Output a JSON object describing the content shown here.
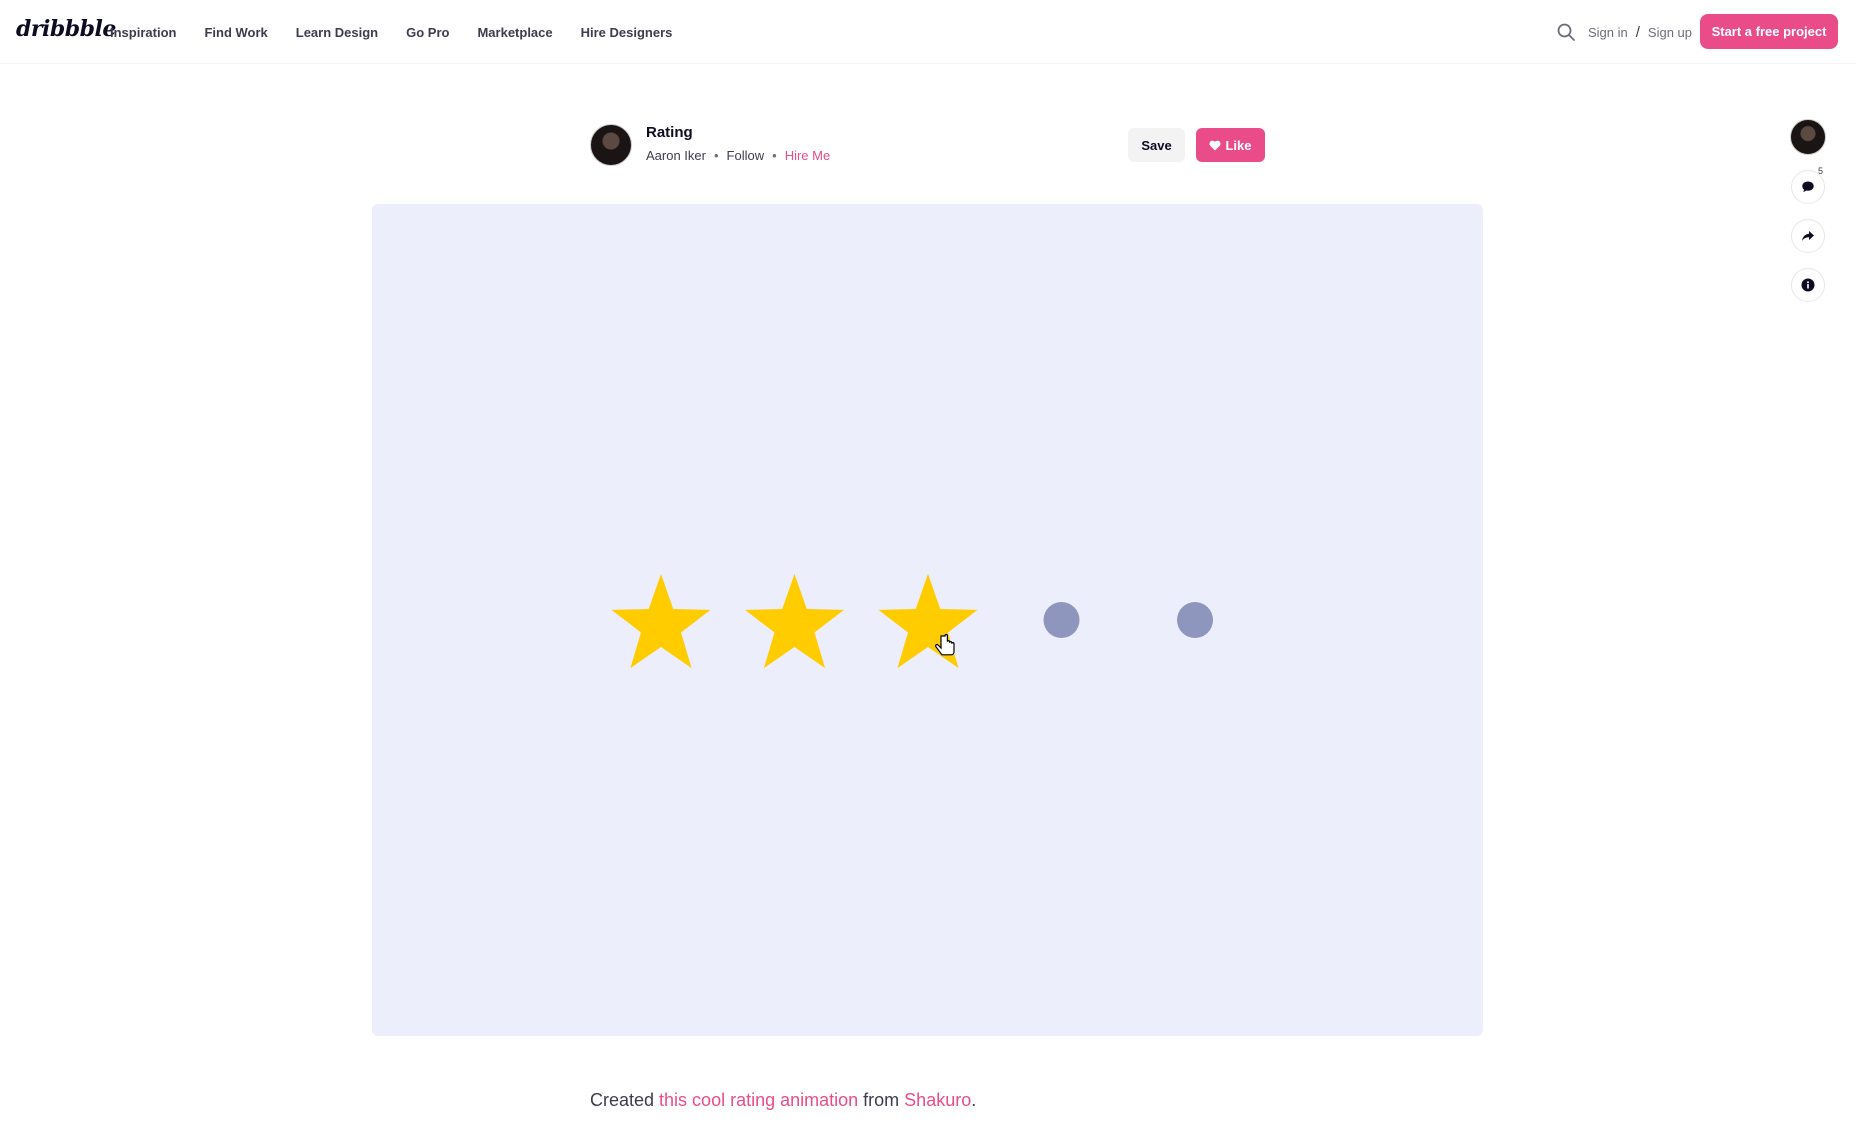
{
  "header": {
    "logo": "dribbble",
    "nav": [
      "Inspiration",
      "Find Work",
      "Learn Design",
      "Go Pro",
      "Marketplace",
      "Hire Designers"
    ],
    "sign_in": "Sign in",
    "separator": "/",
    "sign_up": "Sign up",
    "cta": "Start a free project"
  },
  "shot": {
    "title": "Rating",
    "author": "Aaron Iker",
    "bullet": "•",
    "follow": "Follow",
    "hire": "Hire Me",
    "save": "Save",
    "like": "Like"
  },
  "rating": {
    "filled": 3,
    "total": 5,
    "star_color": "#ffcc00",
    "empty_color": "#8f96bd"
  },
  "sidebar": {
    "comments_count": "5"
  },
  "description": {
    "prefix": "Created ",
    "link1": "this cool rating animation",
    "middle": " from ",
    "link2": "Shakuro",
    "suffix": "."
  },
  "colors": {
    "brand_pink": "#ea4c89",
    "canvas_bg": "#eceefc"
  }
}
